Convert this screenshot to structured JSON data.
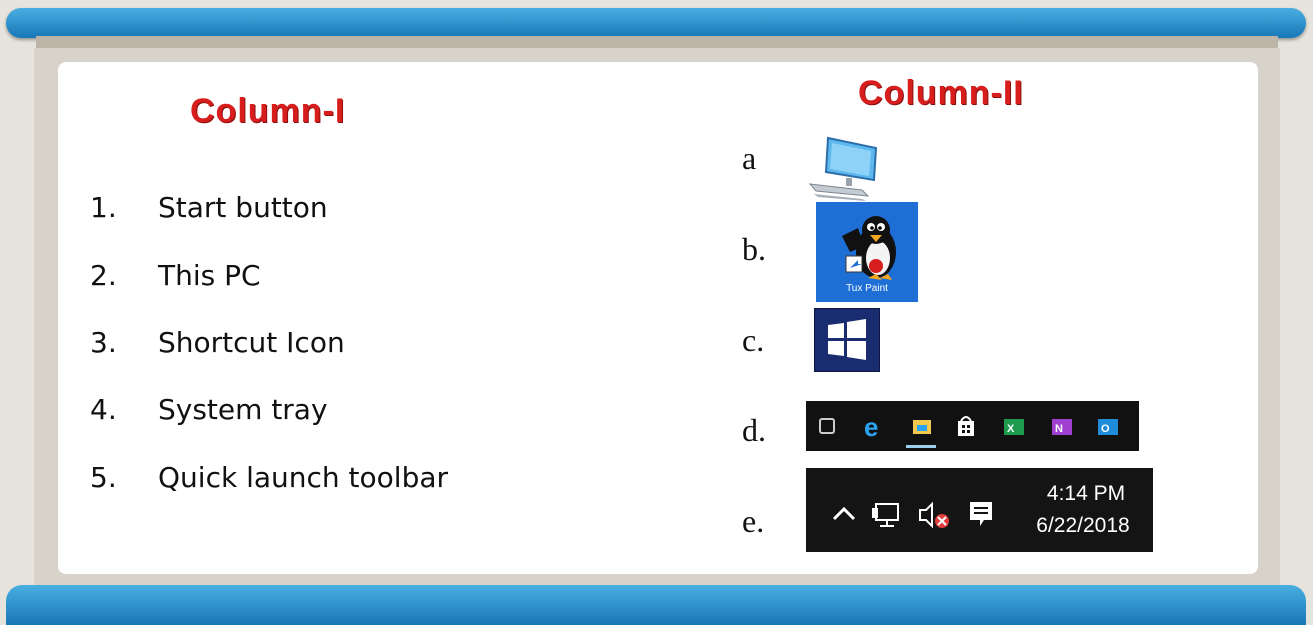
{
  "column1": {
    "title": "Column-I",
    "items": [
      {
        "num": "1.",
        "label": "Start button"
      },
      {
        "num": "2.",
        "label": "This PC"
      },
      {
        "num": "3.",
        "label": "Shortcut Icon"
      },
      {
        "num": "4.",
        "label": "System tray"
      },
      {
        "num": "5.",
        "label": "Quick launch toolbar"
      }
    ]
  },
  "column2": {
    "title": "Column-II",
    "letters": [
      "a",
      "b.",
      "c.",
      "d.",
      "e."
    ],
    "icons": {
      "a": "this-pc-computer-icon",
      "b": "tux-paint-shortcut-icon",
      "c": "windows-start-icon",
      "d": "quick-launch-icons",
      "e": "system-tray-icons"
    },
    "tux_caption": "Tux Paint",
    "tray_time": "4:14 PM",
    "tray_date": "6/22/2018"
  },
  "colors": {
    "banner": "#1877b8",
    "title_red": "#d81d1d",
    "tux_bg": "#1d6fd6",
    "start_bg": "#1a2c70",
    "taskbar": "#111111"
  }
}
